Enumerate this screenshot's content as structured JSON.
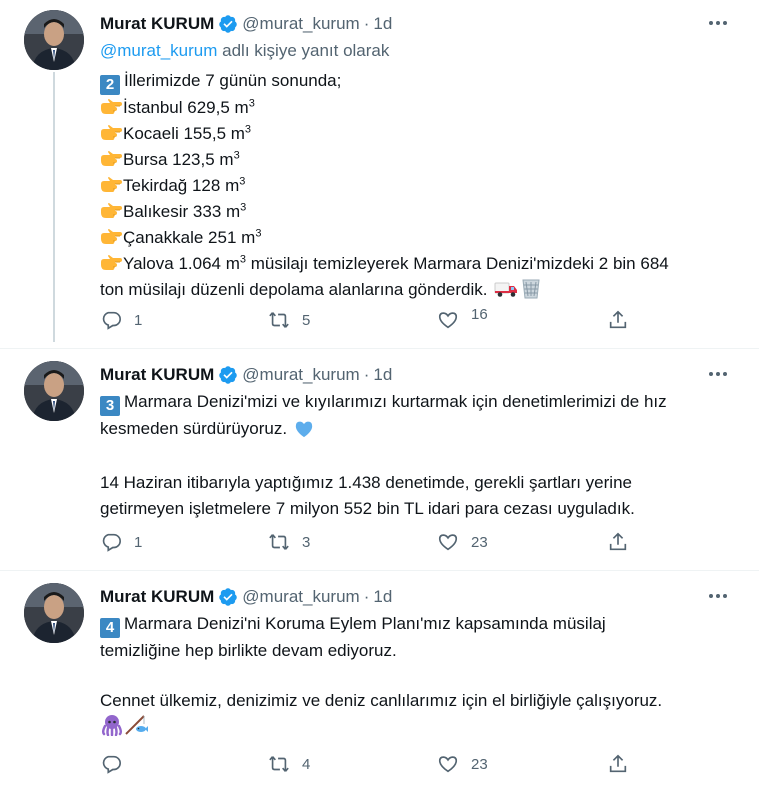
{
  "tweets": [
    {
      "author_name": "Murat KURUM",
      "handle": "@murat_kurum",
      "dot": "·",
      "time": "1d",
      "reply_mention": "@murat_kurum",
      "reply_suffix": " adlı kişiye yanıt olarak",
      "number_label": "2",
      "intro": "İllerimizde 7 günün sonunda;",
      "items": [
        {
          "text": "İstanbul 629,5 m",
          "sup": "3"
        },
        {
          "text": "Kocaeli 155,5 m",
          "sup": "3"
        },
        {
          "text": "Bursa 123,5 m",
          "sup": "3"
        },
        {
          "text": "Tekirdağ 128 m",
          "sup": "3"
        },
        {
          "text": "Balıkesir 333 m",
          "sup": "3"
        },
        {
          "text": "Çanakkale 251 m",
          "sup": "3"
        }
      ],
      "last_item_prefix": "Yalova 1.064 m",
      "last_item_sup": "3",
      "last_item_suffix": " müsilajı temizleyerek Marmara Denizi'mizdeki 2 bin 684",
      "closing": "ton müsilajı düzenli depolama alanlarına gönderdik.",
      "emojis": [
        "delivery-truck",
        "wastebasket"
      ],
      "reply_count": "1",
      "retweet_count": "5",
      "like_count": "16"
    },
    {
      "author_name": "Murat KURUM",
      "handle": "@murat_kurum",
      "dot": "·",
      "time": "1d",
      "number_label": "3",
      "line1": "Marmara Denizi'mizi ve kıyılarımızı kurtarmak için denetimlerimizi de hız",
      "line2": "kesmeden sürdürüyoruz.",
      "line2_emoji": "blue-heart",
      "para2_line1": "14 Haziran itibarıyla yaptığımız 1.438 denetimde, gerekli şartları yerine",
      "para2_line2": "getirmeyen işletmelere 7 milyon 552 bin TL idari para cezası uyguladık.",
      "reply_count": "1",
      "retweet_count": "3",
      "like_count": "23"
    },
    {
      "author_name": "Murat KURUM",
      "handle": "@murat_kurum",
      "dot": "·",
      "time": "1d",
      "number_label": "4",
      "line1": "Marmara Denizi'ni Koruma Eylem Planı'mız kapsamında müsilaj",
      "line2": "temizliğine hep birlikte devam ediyoruz.",
      "para2_line1": "Cennet ülkemiz, denizimiz ve deniz canlılarımız için el birliğiyle çalışıyoruz.",
      "para2_emojis": [
        "octopus",
        "fishing-pole-and-fish"
      ],
      "reply_count": "",
      "retweet_count": "4",
      "like_count": "23"
    }
  ],
  "colors": {
    "accent": "#1d9bf0",
    "secondary_text": "#536471",
    "keycap": "#3b88c3",
    "verified": "#1d9bf0"
  },
  "icons": [
    "verified-badge-icon",
    "more-icon",
    "reply-icon",
    "retweet-icon",
    "like-icon",
    "share-icon",
    "pointing-hand-icon"
  ]
}
